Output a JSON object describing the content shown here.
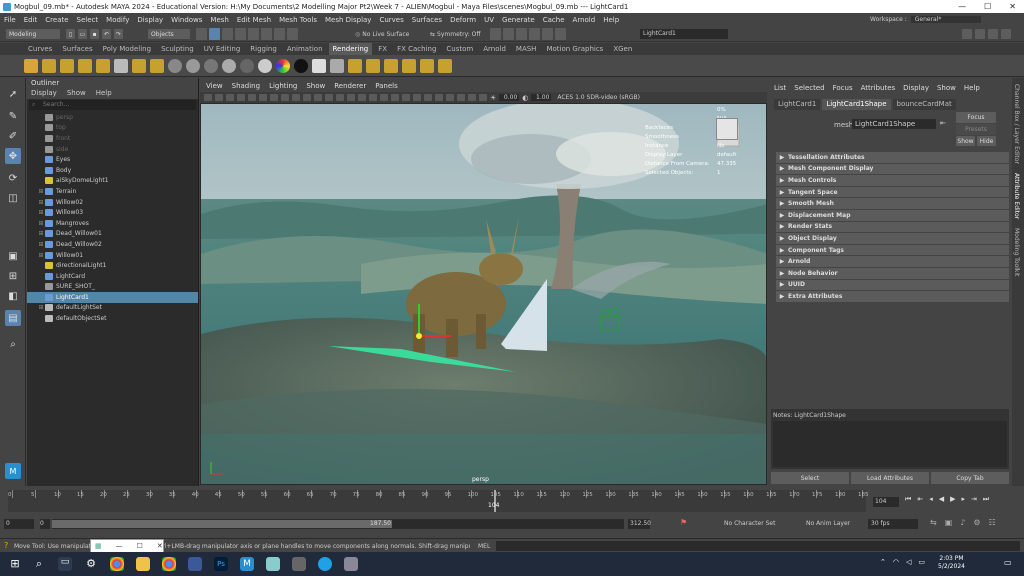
{
  "window": {
    "title": "Mogbul_09.mb* - Autodesk MAYA 2024 - Educational Version: H:\\My Documents\\2 Modelling Major Pt2\\Week 7 - ALIEN\\Mogbul - Maya Files\\scenes\\Mogbul_09.mb  ---  LightCard1",
    "minimize": "—",
    "maximize": "☐",
    "close": "✕"
  },
  "menubar": {
    "items": [
      "File",
      "Edit",
      "Create",
      "Select",
      "Modify",
      "Display",
      "Windows",
      "Mesh",
      "Edit Mesh",
      "Mesh Tools",
      "Mesh Display",
      "Curves",
      "Surfaces",
      "Deform",
      "UV",
      "Generate",
      "Cache",
      "Arnold",
      "Help"
    ],
    "workspace_label": "Workspace :",
    "workspace_value": "General*"
  },
  "statusline": {
    "menuset": "Modeling",
    "objects": "Objects",
    "live_surface": "No Live Surface",
    "symmetry": "Symmetry: Off",
    "name_field": "LightCard1"
  },
  "shelf": {
    "tabs": [
      "Curves",
      "Surfaces",
      "Poly Modeling",
      "Sculpting",
      "UV Editing",
      "Rigging",
      "Animation",
      "Rendering",
      "FX",
      "FX Caching",
      "Custom",
      "Arnold",
      "MASH",
      "Motion Graphics",
      "XGen"
    ],
    "active_tab": "Rendering"
  },
  "outliner": {
    "title": "Outliner",
    "menu": [
      "Display",
      "Show",
      "Help"
    ],
    "search_placeholder": "Search...",
    "items": [
      {
        "label": "persp",
        "expand": "",
        "kind": "camera",
        "dim": true
      },
      {
        "label": "top",
        "expand": "",
        "kind": "camera",
        "dim": true
      },
      {
        "label": "front",
        "expand": "",
        "kind": "camera",
        "dim": true
      },
      {
        "label": "side",
        "expand": "",
        "kind": "camera",
        "dim": true
      },
      {
        "label": "Eyes",
        "expand": "",
        "kind": "mesh",
        "dim": false
      },
      {
        "label": "Body",
        "expand": "",
        "kind": "mesh",
        "dim": false
      },
      {
        "label": "aiSkyDomeLight1",
        "expand": "",
        "kind": "light",
        "dim": false
      },
      {
        "label": "Terrain",
        "expand": "⊞",
        "kind": "mesh",
        "dim": false
      },
      {
        "label": "Willow02",
        "expand": "⊞",
        "kind": "mesh",
        "dim": false
      },
      {
        "label": "Willow03",
        "expand": "⊞",
        "kind": "mesh",
        "dim": false
      },
      {
        "label": "Mangroves",
        "expand": "⊞",
        "kind": "mesh",
        "dim": false
      },
      {
        "label": "Dead_Willow01",
        "expand": "⊞",
        "kind": "mesh",
        "dim": false
      },
      {
        "label": "Dead_Willow02",
        "expand": "⊞",
        "kind": "mesh",
        "dim": false
      },
      {
        "label": "Willow01",
        "expand": "⊞",
        "kind": "mesh",
        "dim": false
      },
      {
        "label": "directionalLight1",
        "expand": "",
        "kind": "light",
        "dim": false
      },
      {
        "label": "LightCard",
        "expand": "",
        "kind": "mesh",
        "dim": false
      },
      {
        "label": "SURE_SHOT_",
        "expand": "",
        "kind": "camera",
        "dim": false
      },
      {
        "label": "LightCard1",
        "expand": "",
        "kind": "mesh",
        "dim": false,
        "selected": true
      },
      {
        "label": "defaultLightSet",
        "expand": "⊞",
        "kind": "set",
        "dim": false
      },
      {
        "label": "defaultObjectSet",
        "expand": "",
        "kind": "set",
        "dim": false
      }
    ]
  },
  "viewport": {
    "menu": [
      "View",
      "Shading",
      "Lighting",
      "Show",
      "Renderer",
      "Panels"
    ],
    "exposure": "0.00",
    "gamma": "1.00",
    "colorspace": "ACES 1.0 SDR-video (sRGB)",
    "camera_label": "persp",
    "hud": {
      "rows": [
        {
          "label": "",
          "value": "0%"
        },
        {
          "label": "",
          "value": "N/A"
        },
        {
          "label": "Backfaces",
          "value": "No"
        },
        {
          "label": "Smoothness",
          "value": "N/A"
        },
        {
          "label": "Instance",
          "value": "No"
        },
        {
          "label": "Display Layer",
          "value": "default"
        },
        {
          "label": "Distance From Camera:",
          "value": "47.335"
        },
        {
          "label": "Selected Objects:",
          "value": "1"
        }
      ]
    }
  },
  "attribute_editor": {
    "menu": [
      "List",
      "Selected",
      "Focus",
      "Attributes",
      "Display",
      "Show",
      "Help"
    ],
    "tabs": [
      "LightCard1",
      "LightCard1Shape",
      "bounceCardMat"
    ],
    "active_tab": "LightCard1Shape",
    "mesh_label": "mesh:",
    "mesh_value": "LightCard1Shape",
    "focus_button": "Focus",
    "presets_button": "Presets",
    "show_button": "Show",
    "hide_button": "Hide",
    "sections": [
      "Tessellation Attributes",
      "Mesh Component Display",
      "Mesh Controls",
      "Tangent Space",
      "Smooth Mesh",
      "Displacement Map",
      "Render Stats",
      "Object Display",
      "Component Tags",
      "Arnold",
      "Node Behavior",
      "UUID",
      "Extra Attributes"
    ],
    "notes_label": "Notes:  LightCard1Shape",
    "select_button": "Select",
    "load_button": "Load Attributes",
    "copy_button": "Copy Tab"
  },
  "side_tabs": [
    "Channel Box / Layer Editor",
    "Attribute Editor",
    "Modeling Toolkit"
  ],
  "timeline": {
    "ticks": [
      "0",
      "5",
      "10",
      "15",
      "20",
      "25",
      "30",
      "35",
      "40",
      "45",
      "50",
      "55",
      "60",
      "65",
      "70",
      "75",
      "80",
      "85",
      "90",
      "95",
      "100",
      "105",
      "110",
      "115",
      "120",
      "125",
      "130",
      "135",
      "140",
      "145",
      "150",
      "155",
      "160",
      "165",
      "170",
      "175",
      "180",
      "185"
    ],
    "current_frame_label": "104",
    "current_frame_field": "104",
    "start_frame": "0",
    "range_start": "0",
    "range_mid": "187.50",
    "range_end": "312.50",
    "character_set": "No Character Set",
    "anim_layer": "No Anim Layer",
    "fps": "30 fps"
  },
  "commandline": {
    "help_text": "Move Tool: Use manipulator to move object(s). Ctrl+LMB-drag manipulator axis or plane handles to move components along normals. Shift-drag manipulator axis or plane handles to extrude components or clone objects. Ctrl+Shift+LMB+drag to constrain movement to a connected edge.",
    "mel_label": "MEL"
  },
  "taskbar": {
    "time": "2:03 PM",
    "date": "5/2/2024"
  }
}
